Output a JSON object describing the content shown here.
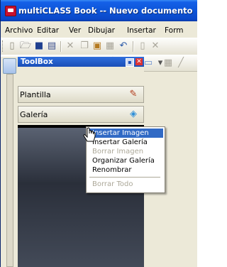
{
  "window": {
    "title": "multiCLASS Book -- Nuevo documento"
  },
  "menubar": {
    "items": [
      "Archivo",
      "Editar",
      "Ver",
      "Dibujar",
      "Insertar",
      "Form"
    ]
  },
  "toolbox": {
    "title": "ToolBox",
    "sections": [
      {
        "label": "Plantilla",
        "icon": "template-icon"
      },
      {
        "label": "Galería",
        "icon": "gallery-icon"
      }
    ]
  },
  "context_menu": {
    "items": [
      {
        "label": "Insertar Imagen",
        "state": "highlighted"
      },
      {
        "label": "Insertar Galería",
        "state": "enabled"
      },
      {
        "label": "Borrar Imagen",
        "state": "disabled"
      },
      {
        "label": "Organizar Galería",
        "state": "enabled"
      },
      {
        "label": "Renombrar",
        "state": "enabled"
      },
      {
        "label": "Borrar Todo",
        "state": "disabled"
      }
    ]
  },
  "colors": {
    "titlebar": "#0d55d8",
    "highlight": "#316ac5",
    "menu_bg": "#ece9d8",
    "disabled_text": "#aca899"
  }
}
